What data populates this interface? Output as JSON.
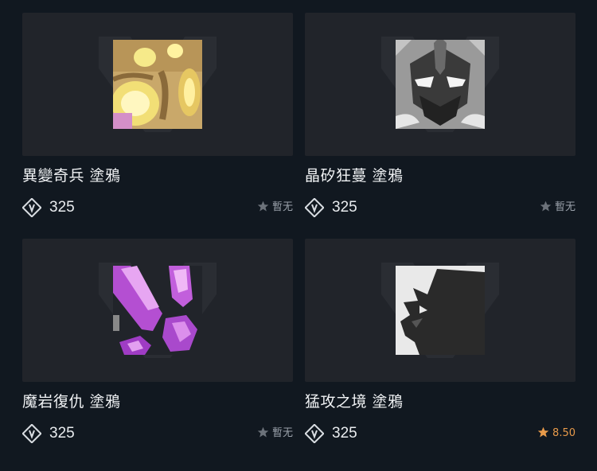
{
  "items": [
    {
      "title": "異變奇兵 塗鴉",
      "price": "325",
      "rating": "暫无",
      "rated": false,
      "icon": "orb-creature-icon"
    },
    {
      "title": "晶矽狂蔓 塗鴉",
      "price": "325",
      "rating": "暫无",
      "rated": false,
      "icon": "masked-face-icon"
    },
    {
      "title": "魔岩復仇 塗鴉",
      "price": "325",
      "rating": "暫无",
      "rated": false,
      "icon": "purple-crystals-icon"
    },
    {
      "title": "猛攻之境 塗鴉",
      "price": "325",
      "rating": "8.50",
      "rated": true,
      "icon": "rhino-silhouette-icon"
    }
  ],
  "colors": {
    "background": "#111820",
    "card": "#21242a",
    "star_unrated": "#6c727a",
    "star_rated": "#e89a4a"
  }
}
